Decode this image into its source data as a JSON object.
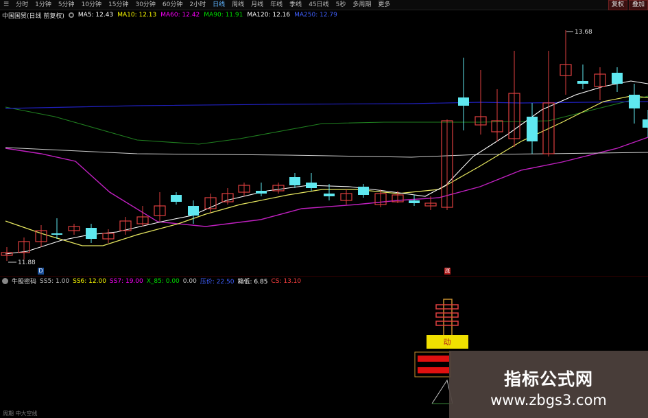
{
  "toolbar": {
    "items": [
      {
        "label": "分时"
      },
      {
        "label": "1分钟"
      },
      {
        "label": "5分钟"
      },
      {
        "label": "10分钟"
      },
      {
        "label": "15分钟"
      },
      {
        "label": "30分钟"
      },
      {
        "label": "60分钟"
      },
      {
        "label": "2小时"
      },
      {
        "label": "日线"
      },
      {
        "label": "周线"
      },
      {
        "label": "月线"
      },
      {
        "label": "年线"
      },
      {
        "label": "季线"
      },
      {
        "label": "45日线"
      },
      {
        "label": "5秒"
      },
      {
        "label": "多周期"
      },
      {
        "label": "更多"
      }
    ],
    "active_index": 8,
    "right_buttons": [
      "复权",
      "叠加"
    ]
  },
  "main_indicator": {
    "name": "中国国贸(日线 前复权)",
    "items": [
      {
        "label": "MA5: 12.43",
        "color": "#ffffff"
      },
      {
        "label": "MA10: 12.13",
        "color": "#ffff00"
      },
      {
        "label": "MA60: 12.42",
        "color": "#ff00ff"
      },
      {
        "label": "MA90: 11.91",
        "color": "#00e000"
      },
      {
        "label": "MA120: 12.16",
        "color": "#ffffff"
      },
      {
        "label": "MA250: 12.79",
        "color": "#4040ff"
      }
    ]
  },
  "sub_indicator": {
    "name": "牛股密码",
    "items": [
      {
        "label": "SS5: 1.00",
        "color": "#c8c8c8"
      },
      {
        "label": "SS6: 12.00",
        "color": "#ffff00"
      },
      {
        "label": "SS7: 19.00",
        "color": "#ff00ff"
      },
      {
        "label": "X_85: 0.00",
        "color": "#00e000"
      },
      {
        "label": "0.00",
        "color": "#c8c8c8"
      },
      {
        "label": "压价: 22.50",
        "color": "#4040ff"
      },
      {
        "label": "箱低: 6.85",
        "color": "#ffffff"
      },
      {
        "label": "CS: 13.10",
        "color": "#ff4040"
      }
    ]
  },
  "price_labels": {
    "high": "13.68",
    "low": "11.88"
  },
  "markers": {
    "left": "D",
    "mid": "涨",
    "sub": "动"
  },
  "status_bar": "周期 中大空线",
  "watermark": {
    "title": "指标公式网",
    "url": "www.zbgs3.com"
  },
  "colors": {
    "up": "#e04040",
    "down": "#5fe8f0",
    "ma5": "#ffffff",
    "ma10": "#e8e860",
    "ma60": "#c020c0",
    "ma90": "#208020",
    "ma120": "#d0d0d0",
    "ma250": "#2020c0"
  }
}
